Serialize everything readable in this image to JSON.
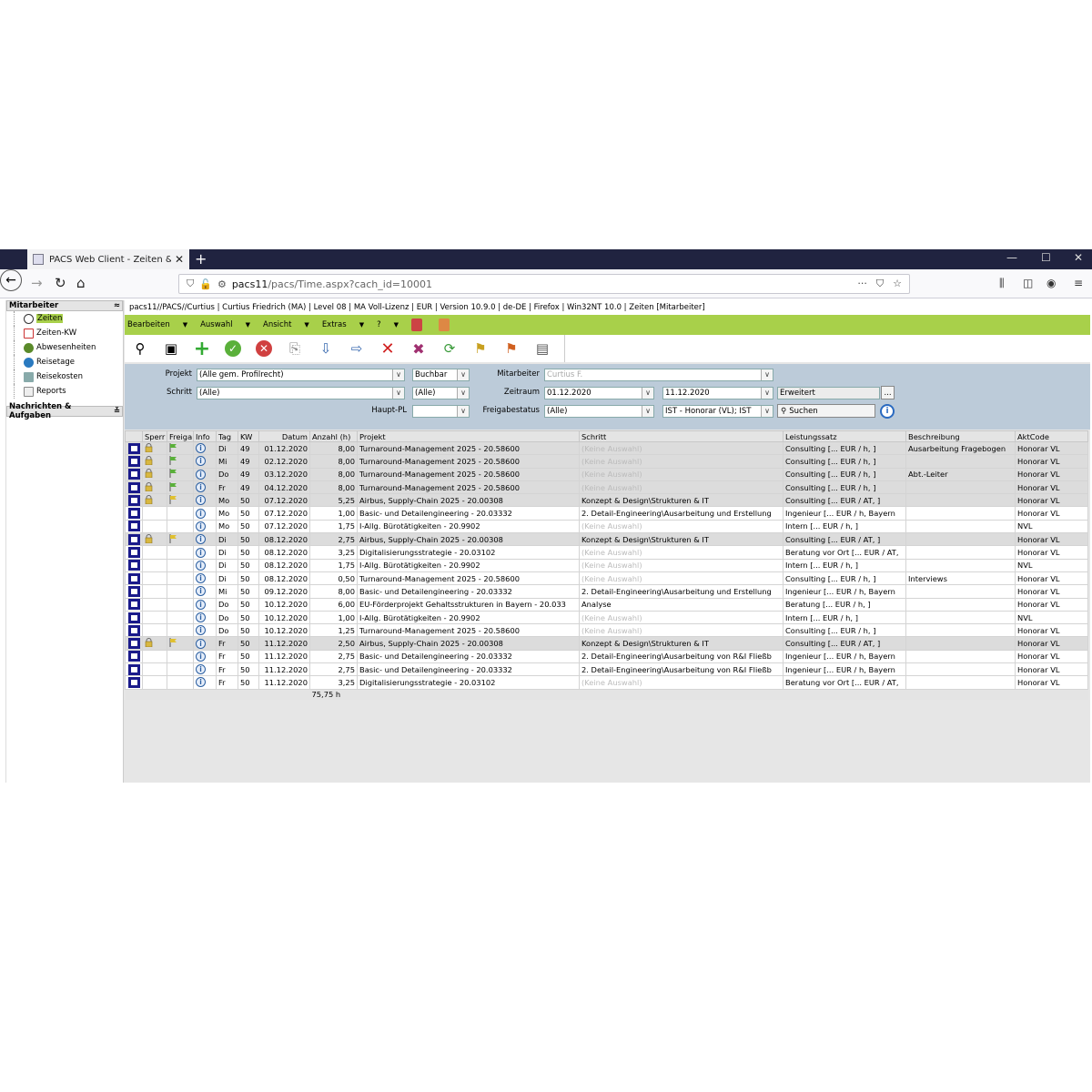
{
  "browser": {
    "tab_title": "PACS Web Client - Zeiten & Ko",
    "url_host": "pacs11",
    "url_rest": "/pacs/Time.aspx?cach_id=10001"
  },
  "sidebar": {
    "section1_title": "Mitarbeiter",
    "items": [
      {
        "label": "Zeiten",
        "icon": "clock-icon"
      },
      {
        "label": "Zeiten-KW",
        "icon": "calendar-icon"
      },
      {
        "label": "Abwesenheiten",
        "icon": "person-icon"
      },
      {
        "label": "Reisetage",
        "icon": "globe-icon"
      },
      {
        "label": "Reisekosten",
        "icon": "chart-icon"
      },
      {
        "label": "Reports",
        "icon": "report-icon"
      }
    ],
    "section2_title": "Nachrichten & Aufgaben"
  },
  "infobar": "pacs11//PACS//Curtius | Curtius Friedrich (MA) | Level 08 | MA Voll-Lizenz | EUR | Version 10.9.0 | de-DE | Firefox | Win32NT 10.0 | Zeiten [Mitarbeiter]",
  "menu": [
    "Bearbeiten",
    "Auswahl",
    "Ansicht",
    "Extras",
    "?"
  ],
  "filters": {
    "projekt_label": "Projekt",
    "projekt_value": "(Alle gem. Profilrecht)",
    "buchbar_value": "Buchbar",
    "schritt_label": "Schritt",
    "schritt_value": "(Alle)",
    "schritt2_value": "(Alle)",
    "hauptpl_label": "Haupt-PL",
    "mitarbeiter_label": "Mitarbeiter",
    "mitarbeiter_value": "Curtius F.",
    "zeitraum_label": "Zeitraum",
    "zeitraum_from": "01.12.2020",
    "zeitraum_to": "11.12.2020",
    "erweitert_label": "Erweitert",
    "freigabe_label": "Freigabestatus",
    "freigabe_value": "(Alle)",
    "ist_value": "IST - Honorar (VL); IST",
    "suchen_label": "Suchen",
    "more_label": "..."
  },
  "grid": {
    "headers": [
      "Sperr",
      "Freiga",
      "Info",
      "Tag",
      "KW",
      "Datum",
      "Anzahl (h)",
      "Projekt",
      "Schritt",
      "Leistungssatz",
      "Beschreibung",
      "AktCode"
    ],
    "rows": [
      {
        "locked": true,
        "lock": true,
        "flag": "green",
        "tag": "Di",
        "kw": "49",
        "datum": "01.12.2020",
        "anzahl": "8,00",
        "projekt": "Turnaround-Management 2025 - 20.58600",
        "schritt": "(Keine Auswahl)",
        "schritt_grey": true,
        "leistung": "Consulting [... EUR / h, ]",
        "beschr": "Ausarbeitung Fragebogen",
        "akt": "Honorar VL"
      },
      {
        "locked": true,
        "lock": true,
        "flag": "green",
        "tag": "Mi",
        "kw": "49",
        "datum": "02.12.2020",
        "anzahl": "8,00",
        "projekt": "Turnaround-Management 2025 - 20.58600",
        "schritt": "(Keine Auswahl)",
        "schritt_grey": true,
        "leistung": "Consulting [... EUR / h, ]",
        "beschr": "",
        "akt": "Honorar VL"
      },
      {
        "locked": true,
        "lock": true,
        "flag": "green",
        "tag": "Do",
        "kw": "49",
        "datum": "03.12.2020",
        "anzahl": "8,00",
        "projekt": "Turnaround-Management 2025 - 20.58600",
        "schritt": "(Keine Auswahl)",
        "schritt_grey": true,
        "leistung": "Consulting [... EUR / h, ]",
        "beschr": "Abt.-Leiter",
        "akt": "Honorar VL"
      },
      {
        "locked": true,
        "lock": true,
        "flag": "green",
        "tag": "Fr",
        "kw": "49",
        "datum": "04.12.2020",
        "anzahl": "8,00",
        "projekt": "Turnaround-Management 2025 - 20.58600",
        "schritt": "(Keine Auswahl)",
        "schritt_grey": true,
        "leistung": "Consulting [... EUR / h, ]",
        "beschr": "",
        "akt": "Honorar VL"
      },
      {
        "locked": true,
        "lock": true,
        "flag": "yellow",
        "tag": "Mo",
        "kw": "50",
        "datum": "07.12.2020",
        "anzahl": "5,25",
        "projekt": "Airbus, Supply-Chain 2025 - 20.00308",
        "schritt": "Konzept & Design\\Strukturen & IT",
        "schritt_grey": false,
        "leistung": "Consulting [... EUR / AT, ]",
        "beschr": "",
        "akt": "Honorar VL"
      },
      {
        "locked": false,
        "lock": false,
        "flag": "",
        "tag": "Mo",
        "kw": "50",
        "datum": "07.12.2020",
        "anzahl": "1,00",
        "projekt": "Basic- und Detailengineering - 20.03332",
        "schritt": "2. Detail-Engineering\\Ausarbeitung und Erstellung",
        "schritt_grey": false,
        "leistung": "Ingenieur [... EUR / h, Bayern",
        "beschr": "",
        "akt": "Honorar VL"
      },
      {
        "locked": false,
        "lock": false,
        "flag": "",
        "tag": "Mo",
        "kw": "50",
        "datum": "07.12.2020",
        "anzahl": "1,75",
        "projekt": "I-Allg. Bürotätigkeiten - 20.9902",
        "schritt": "(Keine Auswahl)",
        "schritt_grey": true,
        "leistung": "Intern [... EUR / h, ]",
        "beschr": "",
        "akt": "NVL"
      },
      {
        "locked": true,
        "lock": true,
        "flag": "yellow",
        "tag": "Di",
        "kw": "50",
        "datum": "08.12.2020",
        "anzahl": "2,75",
        "projekt": "Airbus, Supply-Chain 2025 - 20.00308",
        "schritt": "Konzept & Design\\Strukturen & IT",
        "schritt_grey": false,
        "leistung": "Consulting [... EUR / AT, ]",
        "beschr": "",
        "akt": "Honorar VL"
      },
      {
        "locked": false,
        "lock": false,
        "flag": "",
        "tag": "Di",
        "kw": "50",
        "datum": "08.12.2020",
        "anzahl": "3,25",
        "projekt": "Digitalisierungsstrategie - 20.03102",
        "schritt": "(Keine Auswahl)",
        "schritt_grey": true,
        "leistung": "Beratung vor Ort [... EUR / AT,",
        "beschr": "",
        "akt": "Honorar VL"
      },
      {
        "locked": false,
        "lock": false,
        "flag": "",
        "tag": "Di",
        "kw": "50",
        "datum": "08.12.2020",
        "anzahl": "1,75",
        "projekt": "I-Allg. Bürotätigkeiten - 20.9902",
        "schritt": "(Keine Auswahl)",
        "schritt_grey": true,
        "leistung": "Intern [... EUR / h, ]",
        "beschr": "",
        "akt": "NVL"
      },
      {
        "locked": false,
        "lock": false,
        "flag": "",
        "tag": "Di",
        "kw": "50",
        "datum": "08.12.2020",
        "anzahl": "0,50",
        "projekt": "Turnaround-Management 2025 - 20.58600",
        "schritt": "(Keine Auswahl)",
        "schritt_grey": true,
        "leistung": "Consulting [... EUR / h, ]",
        "beschr": "Interviews",
        "akt": "Honorar VL"
      },
      {
        "locked": false,
        "lock": false,
        "flag": "",
        "tag": "Mi",
        "kw": "50",
        "datum": "09.12.2020",
        "anzahl": "8,00",
        "projekt": "Basic- und Detailengineering - 20.03332",
        "schritt": "2. Detail-Engineering\\Ausarbeitung und Erstellung",
        "schritt_grey": false,
        "leistung": "Ingenieur [... EUR / h, Bayern",
        "beschr": "",
        "akt": "Honorar VL"
      },
      {
        "locked": false,
        "lock": false,
        "flag": "",
        "tag": "Do",
        "kw": "50",
        "datum": "10.12.2020",
        "anzahl": "6,00",
        "projekt": "EU-Förderprojekt Gehaltsstrukturen in Bayern - 20.033",
        "schritt": "Analyse",
        "schritt_grey": false,
        "leistung": "Beratung [... EUR / h, ]",
        "beschr": "",
        "akt": "Honorar VL"
      },
      {
        "locked": false,
        "lock": false,
        "flag": "",
        "tag": "Do",
        "kw": "50",
        "datum": "10.12.2020",
        "anzahl": "1,00",
        "projekt": "I-Allg. Bürotätigkeiten - 20.9902",
        "schritt": "(Keine Auswahl)",
        "schritt_grey": true,
        "leistung": "Intern [... EUR / h, ]",
        "beschr": "",
        "akt": "NVL"
      },
      {
        "locked": false,
        "lock": false,
        "flag": "",
        "tag": "Do",
        "kw": "50",
        "datum": "10.12.2020",
        "anzahl": "1,25",
        "projekt": "Turnaround-Management 2025 - 20.58600",
        "schritt": "(Keine Auswahl)",
        "schritt_grey": true,
        "leistung": "Consulting [... EUR / h, ]",
        "beschr": "",
        "akt": "Honorar VL"
      },
      {
        "locked": true,
        "lock": true,
        "flag": "yellow",
        "tag": "Fr",
        "kw": "50",
        "datum": "11.12.2020",
        "anzahl": "2,50",
        "projekt": "Airbus, Supply-Chain 2025 - 20.00308",
        "schritt": "Konzept & Design\\Strukturen & IT",
        "schritt_grey": false,
        "leistung": "Consulting [... EUR / AT, ]",
        "beschr": "",
        "akt": "Honorar VL"
      },
      {
        "locked": false,
        "lock": false,
        "flag": "",
        "tag": "Fr",
        "kw": "50",
        "datum": "11.12.2020",
        "anzahl": "2,75",
        "projekt": "Basic- und Detailengineering - 20.03332",
        "schritt": "2. Detail-Engineering\\Ausarbeitung von R&I Fließb",
        "schritt_grey": false,
        "leistung": "Ingenieur [... EUR / h, Bayern",
        "beschr": "",
        "akt": "Honorar VL"
      },
      {
        "locked": false,
        "lock": false,
        "flag": "",
        "tag": "Fr",
        "kw": "50",
        "datum": "11.12.2020",
        "anzahl": "2,75",
        "projekt": "Basic- und Detailengineering - 20.03332",
        "schritt": "2. Detail-Engineering\\Ausarbeitung von R&I Fließb",
        "schritt_grey": false,
        "leistung": "Ingenieur [... EUR / h, Bayern",
        "beschr": "",
        "akt": "Honorar VL"
      },
      {
        "locked": false,
        "lock": false,
        "flag": "",
        "tag": "Fr",
        "kw": "50",
        "datum": "11.12.2020",
        "anzahl": "3,25",
        "projekt": "Digitalisierungsstrategie - 20.03102",
        "schritt": "(Keine Auswahl)",
        "schritt_grey": true,
        "leistung": "Beratung vor Ort [... EUR / AT,",
        "beschr": "",
        "akt": "Honorar VL"
      }
    ],
    "total": "75,75 h"
  },
  "colors": {
    "accent_green": "#a8d04a",
    "filter_bg": "#bccbd9",
    "checkbox_border": "#1a1a8a"
  }
}
